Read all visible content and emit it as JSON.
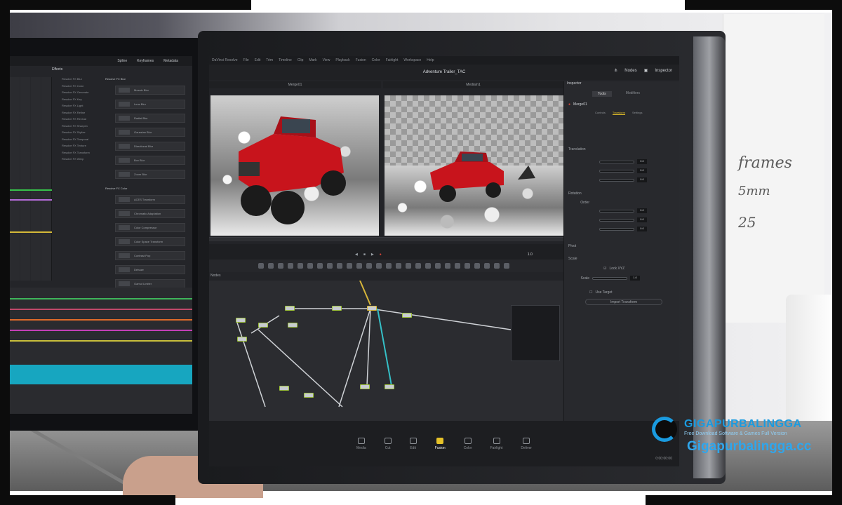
{
  "app": {
    "menu": [
      "DaVinci Resolve",
      "File",
      "Edit",
      "Trim",
      "Timeline",
      "Clip",
      "Mark",
      "View",
      "Playback",
      "Fusion",
      "Color",
      "Fairlight",
      "Workspace",
      "Help"
    ],
    "title": "Adventure Trailer_TAC",
    "splines_label": "Spline",
    "keyframes_label": "Keyframes",
    "metadata_label": "Metadata",
    "effects_label": "Effects",
    "nodes_btn": "Nodes",
    "inspector_btn": "Inspector"
  },
  "viewer": {
    "left_title": "Merge01",
    "right_title": "MediaIn1"
  },
  "inspector": {
    "title": "Inspector",
    "tab_tools": "Tools",
    "tab_modifiers": "Modifiers",
    "node_name": "Merge01",
    "subtabs": [
      "Controls",
      "Transform",
      "Settings"
    ],
    "translation": "Translation",
    "rotation": "Rotation",
    "order": "Order",
    "pivot": "Pivot",
    "scale": "Scale",
    "lock_xyz": "Lock XYZ",
    "scale_value": "1.0",
    "use_target": "Use Target",
    "import_transform": "Import Transform",
    "values": [
      "0.0",
      "0.0",
      "0.0"
    ],
    "rot_values": [
      "0.0",
      "0.0",
      "0.0"
    ]
  },
  "transport": {
    "zoom": "1.0",
    "nodes_label": "Nodes"
  },
  "effects_list": [
    "Resolve FX Blur",
    "Resolve FX Color",
    "Resolve FX Generate",
    "Resolve FX Key",
    "Resolve FX Light",
    "Resolve FX Refine",
    "Resolve FX Revival",
    "Resolve FX Sharpen",
    "Resolve FX Stylize",
    "Resolve FX Temporal",
    "Resolve FX Texture",
    "Resolve FX Transform",
    "Resolve FX Warp"
  ],
  "effects_left": {
    "group1": "Resolve FX Blur",
    "items1": [
      "Mosaic Blur",
      "Lens Blur",
      "Radial Blur",
      "Gaussian Blur",
      "Directional Blur",
      "Box Blur",
      "Zoom Blur"
    ],
    "group2": "Resolve FX Color",
    "items2": [
      "ACES Transform",
      "Chromatic Adaptation",
      "Color Compressor",
      "Color Space Transform",
      "Contrast Pop",
      "Dehaze",
      "Gamut Limiter"
    ]
  },
  "pages": [
    "Media",
    "Cut",
    "Edit",
    "Fusion",
    "Color",
    "Fairlight",
    "Deliver"
  ],
  "active_page": "Fusion",
  "timecode": "0:00:00:00",
  "poster": [
    "frames",
    "5mm",
    "25"
  ],
  "watermark": {
    "brand": "GIGAPURBALINGGA",
    "tagline": "Free Download Software & Games Full Version",
    "url": "Gigapurbalingga.cc"
  },
  "colors": {
    "accent": "#e6c229",
    "brand": "#1a9be0",
    "node_border": "#9ec33c"
  }
}
